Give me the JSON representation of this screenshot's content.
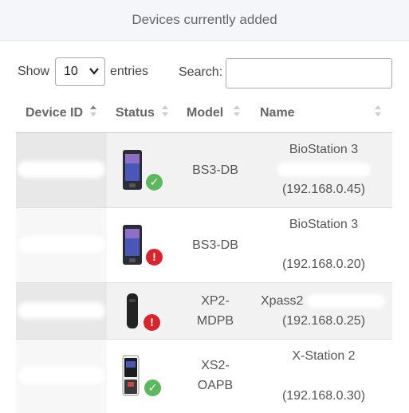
{
  "header": {
    "title": "Devices currently added"
  },
  "controls": {
    "show_label": "Show",
    "entries_value": "10",
    "entries_label": "entries",
    "search_label": "Search:",
    "search_value": ""
  },
  "table": {
    "columns": [
      "Device ID",
      "Status",
      "Model",
      "Name"
    ],
    "rows": [
      {
        "model_l1": "BS3-DB",
        "model_l2": "",
        "name_l1": "BioStation 3",
        "ip": "(192.168.0.45)",
        "status": "connected",
        "device": "biostation-icon"
      },
      {
        "model_l1": "BS3-DB",
        "model_l2": "",
        "name_l1": "BioStation 3",
        "ip": "(192.168.0.20)",
        "status": "error",
        "device": "biostation-icon"
      },
      {
        "model_l1": "XP2-",
        "model_l2": "MDPB",
        "name_l1": "Xpass2",
        "ip": "(192.168.0.25)",
        "status": "error",
        "device": "xpass-reader-icon"
      },
      {
        "model_l1": "XS2-",
        "model_l2": "OAPB",
        "name_l1": "X-Station 2",
        "ip": "(192.168.0.30)",
        "status": "connected",
        "device": "xstation-icon"
      }
    ]
  },
  "colors": {
    "ok": "#5cb85c",
    "error": "#d9232d"
  }
}
